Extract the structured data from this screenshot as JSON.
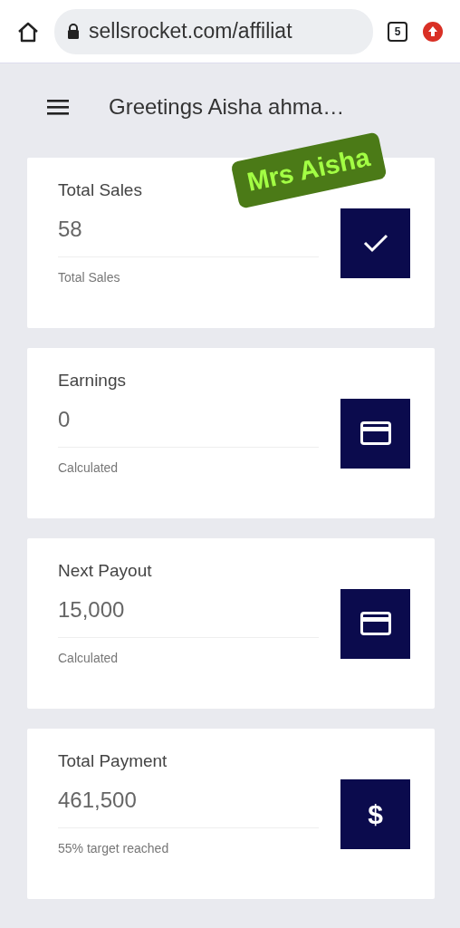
{
  "browser": {
    "url": "sellsrocket.com/affiliat",
    "tab_count": "5"
  },
  "header": {
    "title": "Greetings Aisha ahma…"
  },
  "sticker": {
    "text": "Mrs Aisha"
  },
  "cards": [
    {
      "title": "Total Sales",
      "value": "58",
      "caption": "Total Sales",
      "kind": "check"
    },
    {
      "title": "Earnings",
      "value": "0",
      "caption": "Calculated",
      "kind": "card"
    },
    {
      "title": "Next Payout",
      "value": "15,000",
      "caption": "Calculated",
      "kind": "card"
    },
    {
      "title": "Total Payment",
      "value": "461,500",
      "caption": "55% target reached",
      "kind": "char",
      "icon_char": "$"
    }
  ]
}
